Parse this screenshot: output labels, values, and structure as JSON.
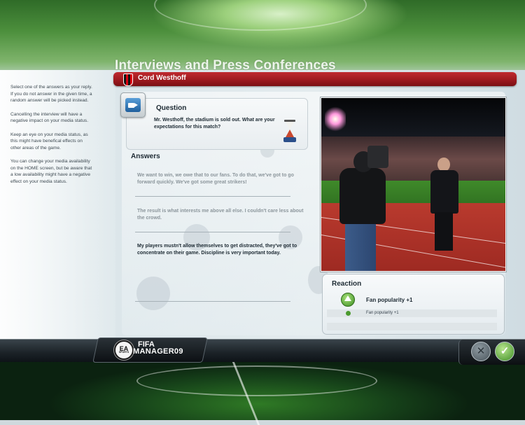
{
  "header": {
    "title": "Interviews and Press Conferences",
    "person_name": "Cord Westhoff"
  },
  "help": {
    "paragraphs": [
      "Select one of the answers as your reply. If you do not answer in the given time, a random answer will be picked instead.",
      "Cancelling the interview will have a negative impact on your media status.",
      "Keep an eye on your media status, as this might have benefical effects on other areas of the game.",
      "You can change your media availability on the HOME screen, but be aware that a low availability might have a negative effect on your media status."
    ]
  },
  "question": {
    "label": "Question",
    "text": "Mr. Westhoff, the stadium is sold out. What are your expectations for this match?"
  },
  "answers": {
    "label": "Answers",
    "items": [
      {
        "text": "We want to win, we owe that to our fans. To do that, we've got to go forward quickly. We've got some great strikers!",
        "state": "dim"
      },
      {
        "text": "The result is what interests me above all else. I couldn't care less about the crowd.",
        "state": "dim"
      },
      {
        "text": "My players mustn't allow themselves to get distracted, they've got to concentrate on their game. Discipline is very important today.",
        "state": "selected"
      }
    ]
  },
  "reaction": {
    "label": "Reaction",
    "main": "Fan popularity +1",
    "rows": [
      "Fan popularity +1"
    ]
  },
  "footer": {
    "ea_logo": "EA",
    "ea_sports": "SPORTS",
    "game_line1": "FIFA",
    "game_line2": "MANAGER09"
  },
  "buttons": {
    "cancel": "✕",
    "confirm": "✓"
  }
}
